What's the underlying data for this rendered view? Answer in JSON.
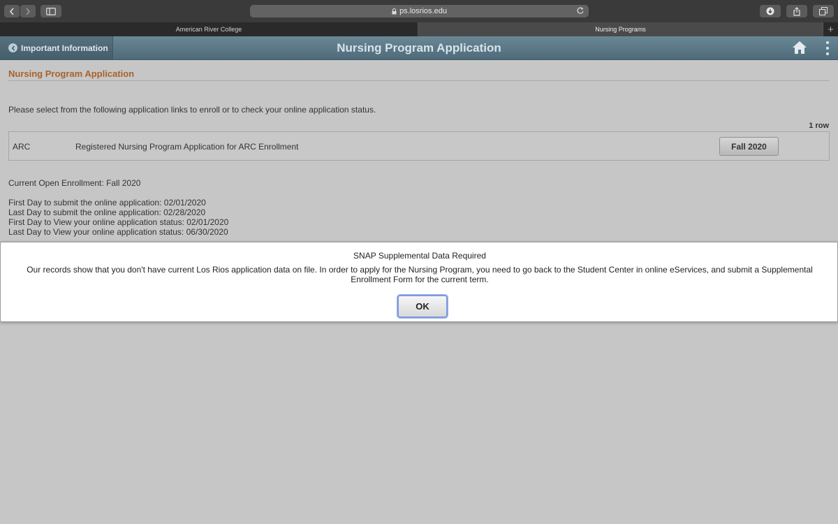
{
  "browser": {
    "url": "ps.losrios.edu",
    "tabs": [
      "American River College",
      "Nursing Programs"
    ],
    "new_tab_label": "+"
  },
  "banner": {
    "back_label": "Important Information",
    "title": "Nursing Program Application"
  },
  "page": {
    "heading": "Nursing Program Application",
    "instructions": "Please select from the following application links to enroll or to check your online application status.",
    "row_count": "1 row",
    "rows": [
      {
        "code": "ARC",
        "description": "Registered Nursing Program Application for ARC Enrollment",
        "term_button": "Fall 2020"
      }
    ],
    "current_enrollment": "Current Open Enrollment: Fall 2020",
    "dates": [
      "First Day to submit the online application: 02/01/2020",
      "Last Day to submit the online application: 02/28/2020",
      "First Day to View your online application status: 02/01/2020",
      "Last Day to View your online application status: 06/30/2020"
    ]
  },
  "modal": {
    "title": "SNAP Supplemental Data Required",
    "message": "Our records show that you don't have current Los Rios application data on file.  In order to apply for the Nursing Program, you need to go back to the Student Center in online eServices, and submit a Supplemental Enrollment Form for the current term.",
    "ok_label": "OK"
  },
  "colors": {
    "heading": "#a8622b",
    "banner": "#5f7b8a",
    "page_background": "#c6c6c6",
    "ok_focus": "#7d9be0"
  },
  "icons": [
    "chevron-left-icon",
    "chevron-right-icon",
    "sidebar-icon",
    "lock-icon",
    "reload-icon",
    "download-icon",
    "share-icon",
    "tabs-icon",
    "back-circle-icon",
    "home-icon",
    "more-vertical-icon"
  ]
}
